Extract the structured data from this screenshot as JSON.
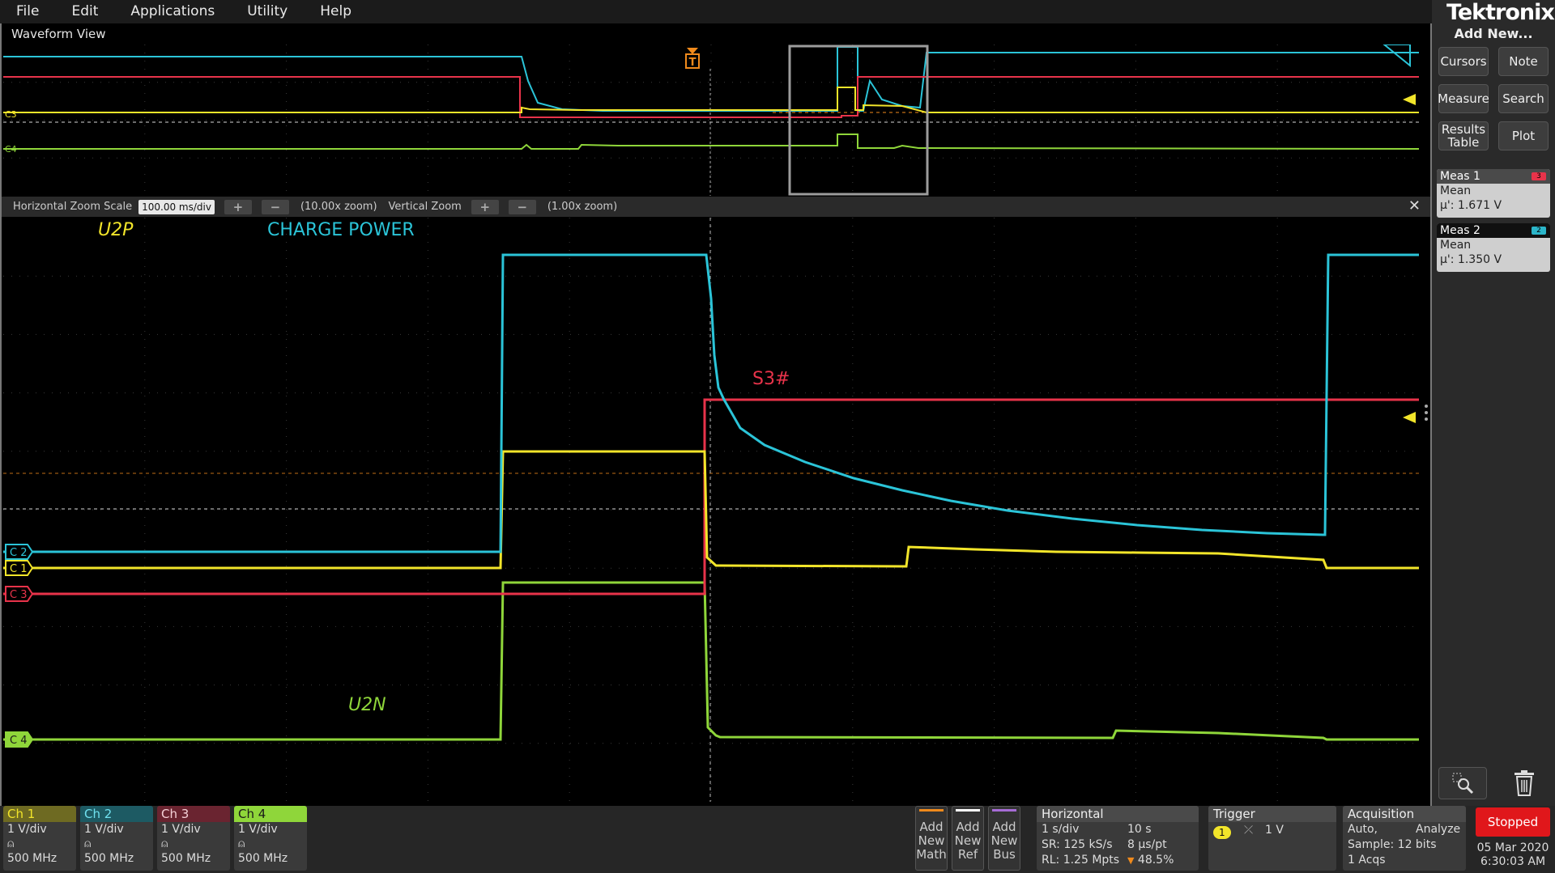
{
  "menu": [
    "File",
    "Edit",
    "Applications",
    "Utility",
    "Help"
  ],
  "brand": "Tektronix",
  "waveform_view_title": "Waveform View",
  "right_panel": {
    "add_new": "Add New...",
    "buttons": [
      "Cursors",
      "Note",
      "Measure",
      "Search",
      "Results Table",
      "Plot"
    ],
    "measurements": [
      {
        "name": "Meas 1",
        "badge": "3",
        "type": "Mean",
        "value": "μ': 1.671 V",
        "color": "#e8334a"
      },
      {
        "name": "Meas 2",
        "badge": "2",
        "type": "Mean",
        "value": "μ': 1.350 V",
        "color": "#2bb5c9"
      }
    ]
  },
  "zoom": {
    "h_label": "Horizontal Zoom Scale",
    "h_value": "100.00 ms/div",
    "h_zoom": "(10.00x zoom)",
    "v_label": "Vertical Zoom",
    "v_zoom": "(1.00x zoom)"
  },
  "annotations": {
    "u2p": "U2P",
    "charge_power": "CHARGE POWER",
    "s3": "S3#",
    "u2n": "U2N"
  },
  "channel_labels": {
    "c1": "C 1",
    "c2": "C 2",
    "c3": "C 3",
    "c4": "C 4"
  },
  "trigger_marker": "T",
  "colors": {
    "ch1": "#f2e52a",
    "ch2": "#2bc4d8",
    "ch3": "#e8334a",
    "ch4": "#8fd63a",
    "trigger": "#f08a1c"
  },
  "channels": [
    {
      "name": "Ch 1",
      "scale": "1 V/div",
      "bw": "500 MHz",
      "head_bg": "#6e6a22",
      "head_fg": "#f2e52a"
    },
    {
      "name": "Ch 2",
      "scale": "1 V/div",
      "bw": "500 MHz",
      "head_bg": "#1d5a63",
      "head_fg": "#6fe0ee"
    },
    {
      "name": "Ch 3",
      "scale": "1 V/div",
      "bw": "500 MHz",
      "head_bg": "#6a2430",
      "head_fg": "#f4d0d6"
    },
    {
      "name": "Ch 4",
      "scale": "1 V/div",
      "bw": "500 MHz",
      "head_bg": "#8fd63a",
      "head_fg": "#1a1a1a"
    }
  ],
  "add_buttons": [
    {
      "label": "Add New Math",
      "color": "#f08a1c"
    },
    {
      "label": "Add New Ref",
      "color": "#ffffff"
    },
    {
      "label": "Add New Bus",
      "color": "#a66cd6"
    }
  ],
  "horizontal": {
    "title": "Horizontal",
    "scale": "1 s/div",
    "length": "10 s",
    "sr": "SR: 125 kS/s",
    "pt": "8 μs/pt",
    "rl": "RL: 1.25 Mpts",
    "pos": "48.5%"
  },
  "trigger": {
    "title": "Trigger",
    "source": "1",
    "level": "1 V"
  },
  "acquisition": {
    "title": "Acquisition",
    "mode": "Auto,",
    "analyze": "Analyze",
    "sample": "Sample: 12 bits",
    "acqs": "1 Acqs"
  },
  "status": "Stopped",
  "date": "05 Mar 2020",
  "time": "6:30:03 AM"
}
